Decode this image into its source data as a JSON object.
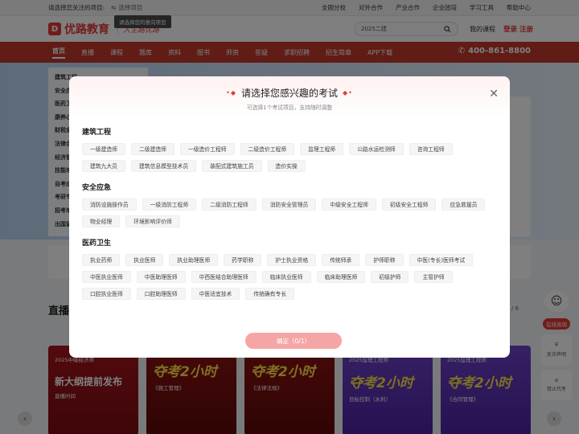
{
  "topbar": {
    "focus_label": "请选择您关注的项目:",
    "select_label": "选择项目",
    "tooltip": "请选择您的意向项目",
    "links": [
      "全国分校",
      "对外合作",
      "产业合作",
      "企业团培",
      "学习工具",
      "帮助中心"
    ]
  },
  "header": {
    "logo_mark": "D",
    "logo_text": "优路教育",
    "slogan": "人生路优路",
    "search_value": "2025二建",
    "my_course": "我的课程",
    "login": "登录",
    "register": "注册"
  },
  "nav": {
    "items": [
      "首页",
      "直播",
      "课程",
      "题库",
      "资料",
      "图书",
      "师资",
      "答疑",
      "求职招聘",
      "招生简章",
      "APP下载"
    ],
    "phone": "400-861-8800"
  },
  "sidemenu": {
    "items": [
      "建筑工程",
      "安全应急",
      "医药卫生",
      "康养心理",
      "财税金融",
      "法律合规",
      "经济管理",
      "技能培训",
      "自考成考",
      "考研专升本",
      "招考培训",
      "出国留学"
    ]
  },
  "live": {
    "title": "直播课",
    "pager": "/ 6",
    "cards": [
      {
        "tag": "2025中级经济师",
        "big": "新大纲提前发布",
        "sm": "直播时间"
      },
      {
        "tag": "",
        "big": "夺考2小时",
        "sm": "《施工管理》"
      },
      {
        "tag": "",
        "big": "夺考2小时",
        "sm": "《法律法规》"
      },
      {
        "tag": "2025监理工程师",
        "big": "夺考2小时",
        "sm": "目标控制（水利）"
      },
      {
        "tag": "2025监理工程师",
        "big": "夺考2小时",
        "sm": "《合同管理》"
      }
    ]
  },
  "floatbar": {
    "consult": "在线咨询",
    "fraud": "反诈声明",
    "exam_ban": "禁止代考"
  },
  "modal": {
    "title": "请选择您感兴趣的考试",
    "subtitle": "可选择1个考试项目，支持随时调整",
    "confirm": "确定（0/1）",
    "categories": [
      {
        "name": "建筑工程",
        "tags": [
          "一级建造师",
          "二级建造师",
          "一级造价工程师",
          "二级造价工程师",
          "监理工程师",
          "公路水运检测师",
          "咨询工程师",
          "建筑九大员",
          "建筑信息模型技术员",
          "装配式建筑施工员",
          "造价实操"
        ]
      },
      {
        "name": "安全应急",
        "tags": [
          "消防设施操作员",
          "一级消防工程师",
          "二级消防工程师",
          "消防安全管理员",
          "中级安全工程师",
          "初级安全工程师",
          "应急救援员",
          "物业经理",
          "环境影响评价师"
        ]
      },
      {
        "name": "医药卫生",
        "tags": [
          "执业药师",
          "执业医师",
          "执业助理医师",
          "药学职称",
          "护士执业资格",
          "传统师承",
          "护师职称",
          "中医(专长)医师考试",
          "中医执业医师",
          "中医助理医师",
          "中西医结合助理医师",
          "临床执业医师",
          "临床助理医师",
          "初级护师",
          "主管护师",
          "口腔执业医师",
          "口腔助理医师",
          "中医适宜技术",
          "传统确有专长"
        ]
      }
    ]
  }
}
